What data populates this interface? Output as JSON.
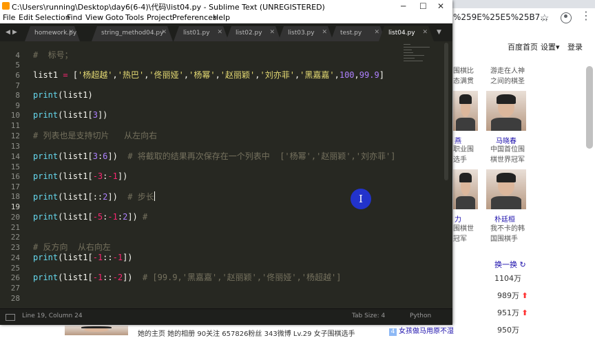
{
  "browser": {
    "url_fragment": "%259E%25E5%25B7...",
    "nav": {
      "home": "百度首页",
      "settings": "设置",
      "settings_arrow": "▾",
      "login": "登录"
    },
    "icons": {
      "star": "☆",
      "menu": "⋮",
      "refresh": "↻",
      "up_arrow": "⬆"
    },
    "people": [
      {
        "caption_top": [
          "围棋比",
          "态满贯"
        ],
        "caption_right": [
          "游走在人神",
          "之间的棋圣"
        ]
      },
      {
        "name": "马晓春",
        "name_left": "燕",
        "caption_left": [
          "职业围",
          "选手"
        ],
        "caption_right": [
          "中国首位围",
          "棋世界冠军"
        ]
      },
      {
        "name": "朴廷桓",
        "name_left": "力",
        "caption_left": [
          "围棋世",
          "冠军"
        ],
        "caption_right": [
          "我不卡的韩",
          "国围棋手"
        ]
      }
    ],
    "refresh_label": "换一换",
    "hot_values": [
      "1104万",
      "989万",
      "951万",
      "950万"
    ],
    "bottom_text": "她的主页 她的相册 90关注 657826粉丝 343微博 Lv.29 女子围棋选手",
    "bottom_rank": "4",
    "bottom_link": "女孩做马用原不湿"
  },
  "window": {
    "title": "C:\\Users\\running\\Desktop\\day6(6-4)\\代码\\list04.py - Sublime Text (UNREGISTERED)",
    "controls": {
      "minimize": "─",
      "maximize": "☐",
      "close": "✕"
    }
  },
  "menu": [
    "File",
    "Edit",
    "Selection",
    "Find",
    "View",
    "Goto",
    "Tools",
    "Project",
    "Preferences",
    "Help"
  ],
  "tabs": [
    {
      "label": "homework.py",
      "active": false
    },
    {
      "label": "string_method04.py",
      "active": false
    },
    {
      "label": "list01.py",
      "active": false
    },
    {
      "label": "list02.py",
      "active": false
    },
    {
      "label": "list03.py",
      "active": false
    },
    {
      "label": "test.py",
      "active": false
    },
    {
      "label": "list04.py",
      "active": true
    }
  ],
  "tab_icons": {
    "close": "✕",
    "nav_left": "◀",
    "nav_right": "▶",
    "dropdown": "▼"
  },
  "editor": {
    "line_numbers": [
      "4",
      "5",
      "6",
      "7",
      "8",
      "9",
      "10",
      "11",
      "12",
      "13",
      "14",
      "15",
      "16",
      "17",
      "18",
      "19",
      "20",
      "21",
      "22",
      "23",
      "24",
      "25",
      "26",
      "27",
      "28"
    ],
    "current_line": "19",
    "code": {
      "l4": "#  标号；",
      "l7": [
        {
          "t": "list1 ",
          "c": ""
        },
        {
          "t": "=",
          "c": "op"
        },
        {
          "t": " [",
          "c": ""
        },
        {
          "t": "'杨超越'",
          "c": "str"
        },
        {
          "t": ",",
          "c": ""
        },
        {
          "t": "'热巴'",
          "c": "str"
        },
        {
          "t": ",",
          "c": ""
        },
        {
          "t": "'佟丽娅'",
          "c": "str"
        },
        {
          "t": ",",
          "c": ""
        },
        {
          "t": "'杨幂'",
          "c": "str"
        },
        {
          "t": ",",
          "c": ""
        },
        {
          "t": "'赵丽颖'",
          "c": "str"
        },
        {
          "t": ",",
          "c": ""
        },
        {
          "t": "'刘亦菲'",
          "c": "str"
        },
        {
          "t": ",",
          "c": ""
        },
        {
          "t": "'黑嘉嘉'",
          "c": "str"
        },
        {
          "t": ",",
          "c": ""
        },
        {
          "t": "100",
          "c": "num"
        },
        {
          "t": ",",
          "c": ""
        },
        {
          "t": "99.9",
          "c": "num"
        },
        {
          "t": "]",
          "c": ""
        }
      ],
      "l9": [
        {
          "t": "print",
          "c": "kw"
        },
        {
          "t": "(list1)",
          "c": ""
        }
      ],
      "l11": [
        {
          "t": "print",
          "c": "kw"
        },
        {
          "t": "(list1[",
          "c": ""
        },
        {
          "t": "3",
          "c": "num"
        },
        {
          "t": "])",
          "c": ""
        }
      ],
      "l13": "# 列表也是支持切片   从左向右",
      "l15": [
        {
          "t": "print",
          "c": "kw"
        },
        {
          "t": "(list1[",
          "c": ""
        },
        {
          "t": "3",
          "c": "num"
        },
        {
          "t": ":",
          "c": ""
        },
        {
          "t": "6",
          "c": "num"
        },
        {
          "t": "])  ",
          "c": ""
        },
        {
          "t": "# 将截取的结果再次保存在一个列表中  ['杨幂','赵丽颖','刘亦菲']",
          "c": "cm"
        }
      ],
      "l17": [
        {
          "t": "print",
          "c": "kw"
        },
        {
          "t": "(list1[",
          "c": ""
        },
        {
          "t": "-3",
          "c": "op"
        },
        {
          "t": ":",
          "c": ""
        },
        {
          "t": "-1",
          "c": "op"
        },
        {
          "t": "])",
          "c": ""
        }
      ],
      "l19": [
        {
          "t": "print",
          "c": "kw"
        },
        {
          "t": "(list1[::",
          "c": ""
        },
        {
          "t": "2",
          "c": "num"
        },
        {
          "t": "])  ",
          "c": ""
        },
        {
          "t": "# 步长",
          "c": "cm"
        }
      ],
      "l21": [
        {
          "t": "print",
          "c": "kw"
        },
        {
          "t": "(list1[",
          "c": ""
        },
        {
          "t": "-5",
          "c": "op"
        },
        {
          "t": ":",
          "c": ""
        },
        {
          "t": "-1",
          "c": "op"
        },
        {
          "t": ":",
          "c": ""
        },
        {
          "t": "2",
          "c": "num"
        },
        {
          "t": "]) ",
          "c": ""
        },
        {
          "t": "#",
          "c": "cm"
        }
      ],
      "l24": "# 反方向  从右向左",
      "l25": [
        {
          "t": "print",
          "c": "kw"
        },
        {
          "t": "(list1[",
          "c": ""
        },
        {
          "t": "-1",
          "c": "op"
        },
        {
          "t": "::",
          "c": ""
        },
        {
          "t": "-1",
          "c": "op"
        },
        {
          "t": "])",
          "c": ""
        }
      ],
      "l27": [
        {
          "t": "print",
          "c": "kw"
        },
        {
          "t": "(list1[",
          "c": ""
        },
        {
          "t": "-1",
          "c": "op"
        },
        {
          "t": "::",
          "c": ""
        },
        {
          "t": "-2",
          "c": "op"
        },
        {
          "t": "])  ",
          "c": ""
        },
        {
          "t": "# [99.9,'黑嘉嘉','赵丽颖','佟丽娅','杨超越']",
          "c": "cm"
        }
      ]
    }
  },
  "status": {
    "position": "Line 19, Column 24",
    "tab_size": "Tab Size: 4",
    "syntax": "Python"
  },
  "cursor_marker_glyph": "I",
  "colors": {
    "editor_bg": "#272822",
    "keyword": "#66d9ef",
    "string": "#e6db74",
    "number": "#ae81ff",
    "operator": "#f92672",
    "comment": "#75715e"
  }
}
